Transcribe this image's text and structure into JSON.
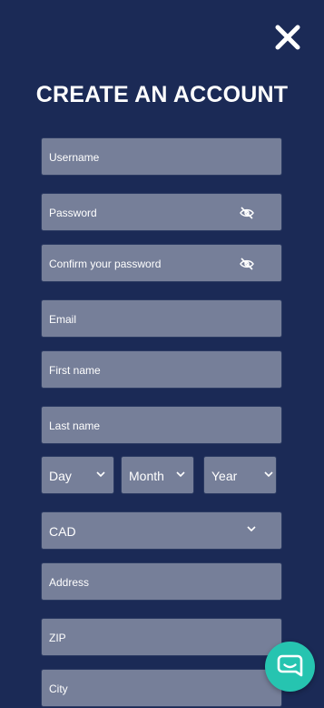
{
  "title": "CREATE AN ACCOUNT",
  "fields": {
    "username": "Username",
    "password": "Password",
    "confirm_password": "Confirm your password",
    "email": "Email",
    "first_name": "First name",
    "last_name": "Last name",
    "address": "Address",
    "zip": "ZIP",
    "city": "City"
  },
  "dob": {
    "day": "Day",
    "month": "Month",
    "year": "Year"
  },
  "currency": {
    "selected": "CAD"
  },
  "icons": {
    "close": "close-icon",
    "password_visibility": "eye-slash-icon",
    "select": "chevron-down-icon",
    "chat": "chat-bubble-icon"
  },
  "colors": {
    "background": "#1b2a56",
    "field": "#767f99",
    "chat_button": "#26c4b0"
  }
}
